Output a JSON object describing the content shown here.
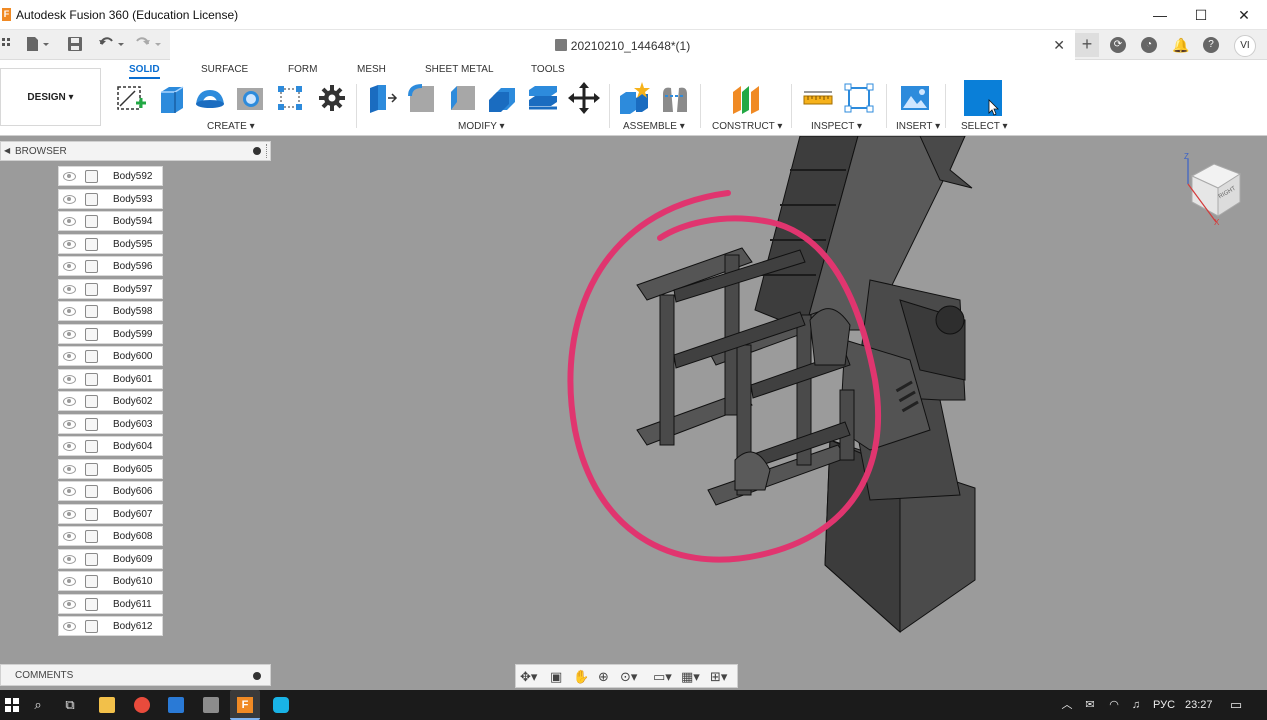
{
  "window": {
    "title": "Autodesk Fusion 360 (Education License)",
    "minimize": "—",
    "maximize": "☐",
    "close": "✕"
  },
  "document": {
    "tab_title": "20210210_144648*(1)",
    "close_tab": "✕"
  },
  "user": {
    "initials": "VI"
  },
  "workspace": {
    "label": "DESIGN ▾"
  },
  "toolbar": {
    "tabs": [
      "SOLID",
      "SURFACE",
      "FORM",
      "MESH",
      "SHEET METAL",
      "TOOLS"
    ],
    "active_tab": "SOLID",
    "groups": [
      "CREATE ▾",
      "MODIFY ▾",
      "ASSEMBLE ▾",
      "CONSTRUCT ▾",
      "INSPECT ▾",
      "INSERT ▾",
      "SELECT ▾"
    ]
  },
  "browser": {
    "title": "BROWSER",
    "items": [
      "Body592",
      "Body593",
      "Body594",
      "Body595",
      "Body596",
      "Body597",
      "Body598",
      "Body599",
      "Body600",
      "Body601",
      "Body602",
      "Body603",
      "Body604",
      "Body605",
      "Body606",
      "Body607",
      "Body608",
      "Body609",
      "Body610",
      "Body611",
      "Body612"
    ]
  },
  "comments": {
    "title": "COMMENTS"
  },
  "viewcube": {
    "face": "RIGHT",
    "z_axis": "Z",
    "x_axis": "X"
  },
  "taskbar": {
    "language": "РУС",
    "time": "23:27"
  },
  "colors": {
    "accent": "#0a6ed1",
    "annotation": "#e0356f",
    "viewport_bg": "#9b9b9b"
  }
}
